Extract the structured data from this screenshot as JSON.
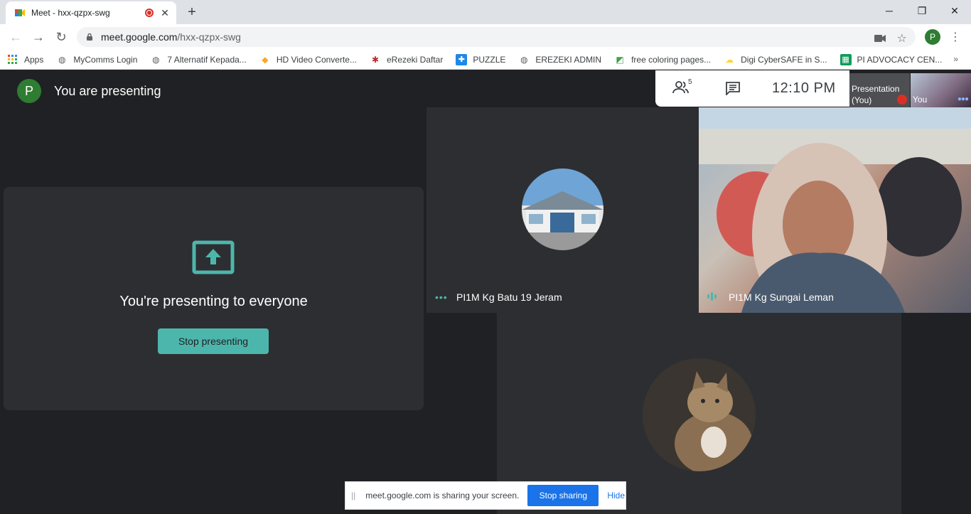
{
  "browser": {
    "tab_title": "Meet - hxx-qzpx-swg",
    "url_domain": "meet.google.com",
    "url_path": "/hxx-qzpx-swg",
    "profile_initial": "P"
  },
  "bookmarks": [
    {
      "label": "Apps",
      "icon": "apps-grid-icon"
    },
    {
      "label": "MyComms Login",
      "icon": "globe-icon"
    },
    {
      "label": "7 Alternatif Kepada...",
      "icon": "globe-icon"
    },
    {
      "label": "HD Video Converte...",
      "icon": "bookmark-icon"
    },
    {
      "label": "eRezeki Daftar",
      "icon": "bookmark-icon"
    },
    {
      "label": "PUZZLE",
      "icon": "puzzle-icon"
    },
    {
      "label": "EREZEKI ADMIN",
      "icon": "globe-icon"
    },
    {
      "label": "free coloring pages...",
      "icon": "bookmark-icon"
    },
    {
      "label": "Digi CyberSAFE in S...",
      "icon": "bookmark-icon"
    },
    {
      "label": "PI ADVOCACY CEN...",
      "icon": "sheets-icon"
    }
  ],
  "meet": {
    "user_initial": "P",
    "heading": "You are presenting",
    "participant_count": "5",
    "clock": "12:10  PM",
    "thumb_presentation_label": "Presentation (You)",
    "thumb_you_label": "You",
    "presenting_message": "You're presenting to everyone",
    "stop_presenting_label": "Stop presenting",
    "tiles": [
      {
        "name": "PI1M Kg Batu 19 Jeram"
      },
      {
        "name": "PI1M Kg Sungai Leman"
      }
    ]
  },
  "share_bar": {
    "message": "meet.google.com is sharing your screen.",
    "stop_label": "Stop sharing",
    "hide_label": "Hide"
  },
  "colors": {
    "accent": "#4db6ac",
    "background": "#202124",
    "tile": "#2d2e31",
    "share_blue": "#1a73e8"
  }
}
